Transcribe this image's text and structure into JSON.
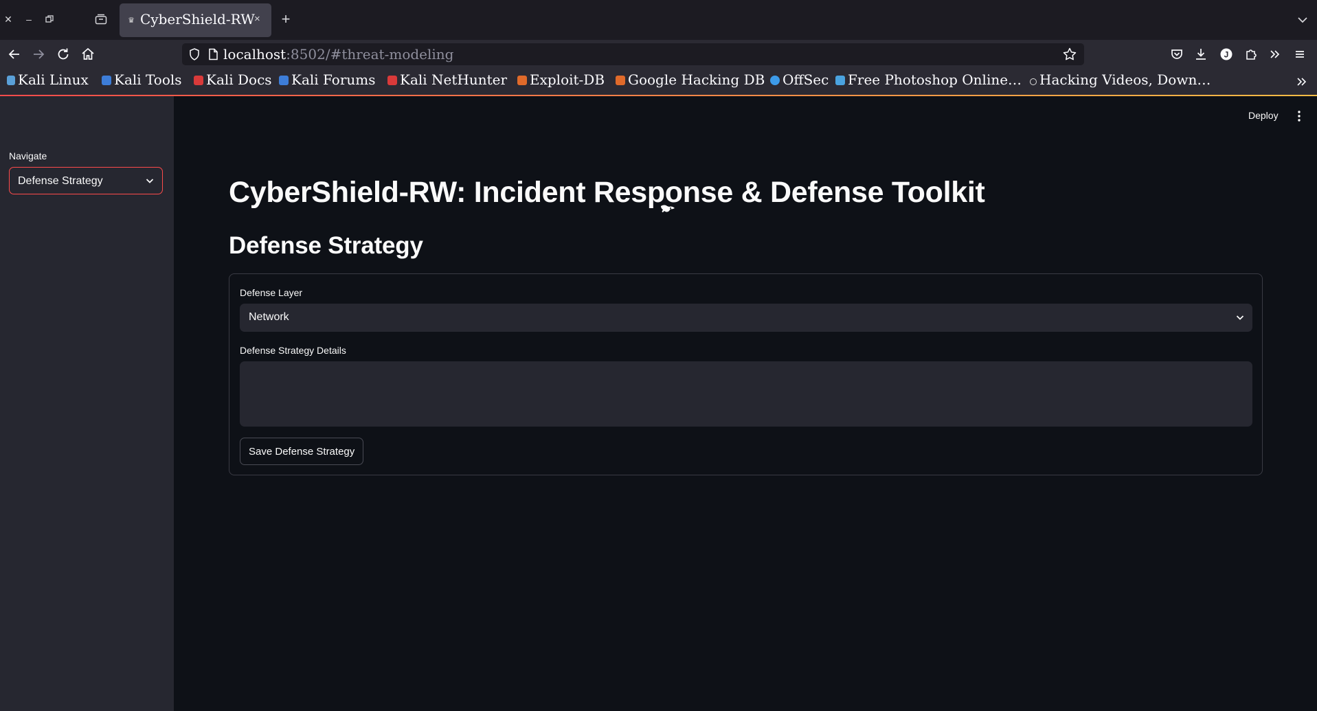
{
  "browser": {
    "tab": {
      "title": "CyberShield-RW",
      "close_glyph": "×"
    },
    "new_tab_glyph": "+",
    "url": {
      "host": "localhost",
      "rest": ":8502/#threat-modeling"
    },
    "bookmarks": [
      {
        "label": "Kali Linux",
        "color": "#5aa0d8"
      },
      {
        "label": "Kali Tools",
        "color": "#3d7dd8"
      },
      {
        "label": "Kali Docs",
        "color": "#d93a3a"
      },
      {
        "label": "Kali Forums",
        "color": "#3d7dd8"
      },
      {
        "label": "Kali NetHunter",
        "color": "#d93a3a"
      },
      {
        "label": "Exploit-DB",
        "color": "#e06a2a"
      },
      {
        "label": "Google Hacking DB",
        "color": "#e06a2a"
      },
      {
        "label": "OffSec",
        "color": "#3d9be9"
      },
      {
        "label": "Free Photoshop Online…",
        "color": "#4aa3df"
      },
      {
        "label": "Hacking Videos, Down…",
        "color": "#dddddd"
      }
    ]
  },
  "app": {
    "toolbar": {
      "deploy_label": "Deploy"
    },
    "sidebar": {
      "nav_label": "Navigate",
      "nav_selected": "Defense Strategy"
    },
    "main": {
      "title": "CyberShield-RW: Incident Response & Defense Toolkit",
      "section_title": "Defense Strategy",
      "form": {
        "layer_label": "Defense Layer",
        "layer_selected": "Network",
        "details_label": "Defense Strategy Details",
        "details_value": "",
        "save_label": "Save Defense Strategy"
      }
    }
  }
}
